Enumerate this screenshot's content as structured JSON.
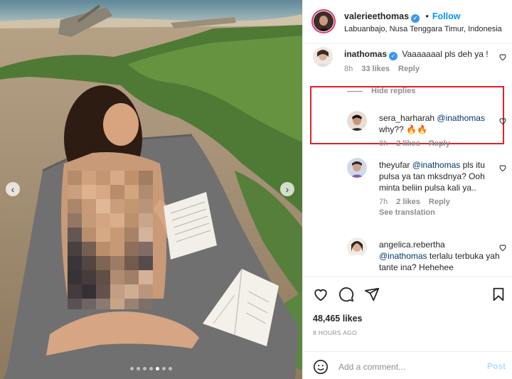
{
  "post": {
    "username": "valerieethomas",
    "separator": "•",
    "follow_label": "Follow",
    "location": "Labuanbajo, Nusa Tenggara Timur, Indonesia",
    "verified_mark": "✓"
  },
  "carousel": {
    "prev_icon": "chevron-left-icon",
    "next_icon": "chevron-right-icon",
    "prev_glyph": "‹",
    "next_glyph": "›",
    "dots": 7,
    "active_dot": 4
  },
  "comments": [
    {
      "username": "inathomas",
      "text": "Vaaaaaaal pls deh ya !",
      "time": "8h",
      "likes": "33 likes",
      "reply": "Reply",
      "hide_replies": "Hide replies",
      "highlighted": true
    },
    {
      "username": "sera_harharah",
      "mention": "@inathomas",
      "text": "why?? 🔥🔥",
      "time": "8h",
      "likes": "2 likes",
      "reply": "Reply"
    },
    {
      "username": "theyufar",
      "mention": "@inathomas",
      "text": "pls itu pulsa ya tan mksdnya? Ooh minta beliin pulsa kali ya..",
      "time": "7h",
      "likes": "2 likes",
      "reply": "Reply",
      "see_translation": "See translation"
    },
    {
      "username": "angelica.rebertha",
      "mention": "@inathomas",
      "text": "terlalu terbuka yah tante ina? Hehehee"
    }
  ],
  "actions": {
    "like_icon": "heart-icon",
    "comment_icon": "comment-icon",
    "share_icon": "share-icon",
    "save_icon": "bookmark-icon",
    "likes": "48,465 likes",
    "time_ago": "8 HOURS AGO"
  },
  "composer": {
    "placeholder": "Add a comment...",
    "post_label": "Post",
    "emoji_icon": "smiley-icon"
  },
  "colors": {
    "accent": "#0095f6",
    "highlight_border": "#e0202a",
    "verified": "#3897f0",
    "muted": "#8e8e8e"
  }
}
